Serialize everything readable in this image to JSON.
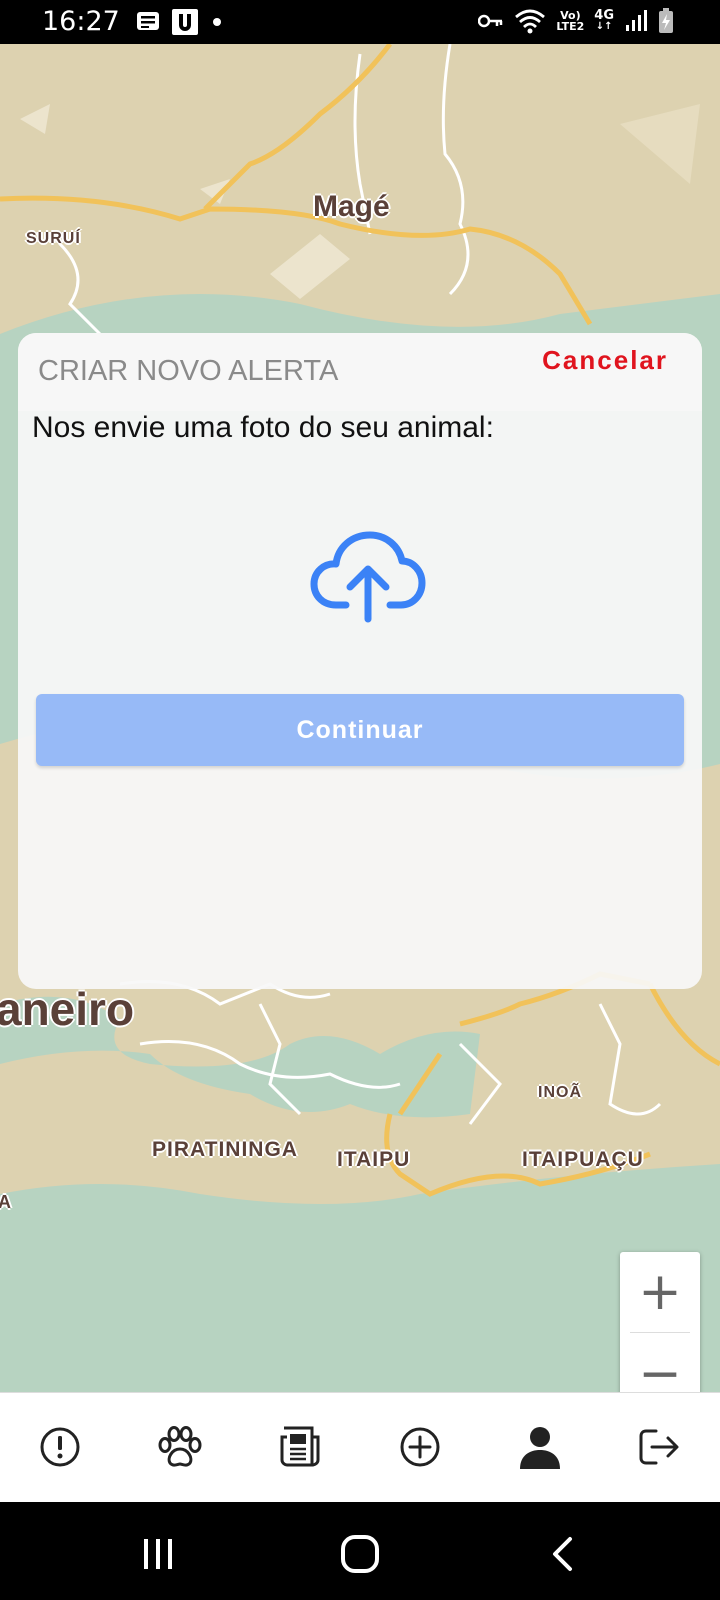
{
  "status_bar": {
    "time": "16:27",
    "net_top": "Vo)",
    "net_bottom": "LTE2",
    "gen_label": "4G"
  },
  "map": {
    "labels": {
      "mage": "Magé",
      "surui": "SURUÍ",
      "rio": "aneiro",
      "piratininga": "PIRATININGA",
      "itaipu": "ITAIPU",
      "itaipuacu": "ITAIPUAÇU",
      "inoa": "INOÃ",
      "a": "A"
    },
    "zoom_in": "+",
    "zoom_out": "−"
  },
  "modal": {
    "title": "CRIAR NOVO ALERTA",
    "cancel": "Cancelar",
    "prompt": "Nos envie uma foto do seu animal:",
    "continue": "Continuar"
  },
  "colors": {
    "accent_blue": "#3b82f6",
    "button_blue": "#97baf7",
    "cancel_red": "#e0141e",
    "land": "#ddd2b0",
    "water": "#b7d3c1",
    "road": "#f1c25a"
  },
  "bottom_nav": {
    "icons": [
      "alert-icon",
      "paw-icon",
      "news-icon",
      "add-circle-icon",
      "user-icon",
      "logout-icon"
    ]
  }
}
